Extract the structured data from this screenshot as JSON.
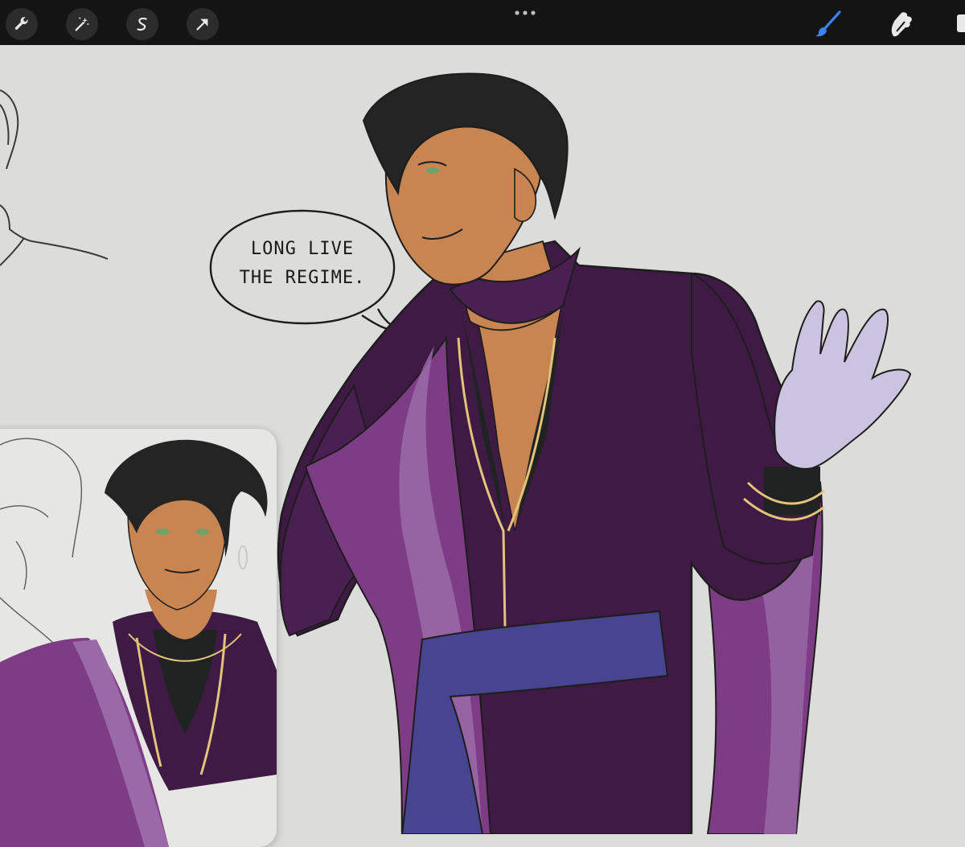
{
  "toolbar": {
    "left_tools": [
      {
        "name": "wrench-icon"
      },
      {
        "name": "magic-wand-icon"
      },
      {
        "name": "selection-s-icon"
      },
      {
        "name": "move-arrow-icon"
      }
    ],
    "more_menu": "more-dots-icon",
    "right_tools": [
      {
        "name": "brush-icon",
        "active": true
      },
      {
        "name": "smudge-icon"
      }
    ],
    "accent_color": "#3b82f6"
  },
  "canvas": {
    "speech_bubble": {
      "line1": "LONG LIVE",
      "line2": "THE REGIME."
    },
    "colors": {
      "background": "#dcdcda",
      "coat": "#3f1a44",
      "sash": "#474490",
      "scarf": "#7e3c84",
      "skin": "#c88451",
      "hair": "#242424",
      "glove": "#cbc4e1",
      "gold": "#e4c37a"
    }
  }
}
